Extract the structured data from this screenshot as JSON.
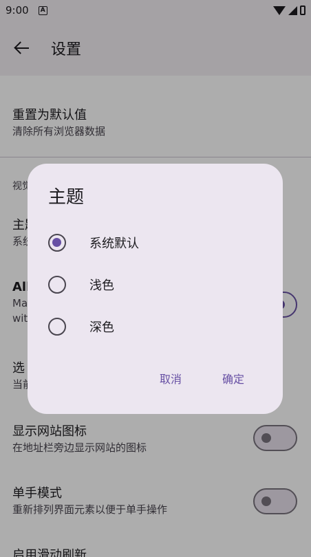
{
  "status_bar": {
    "time": "9:00",
    "notif_glyph": "A"
  },
  "app_bar": {
    "title": "设置",
    "back_icon": "arrow-left-icon"
  },
  "settings": {
    "reset": {
      "title": "重置为默认值",
      "subtitle": "清除所有浏览器数据"
    },
    "section_label": "视觉",
    "theme": {
      "title": "主题",
      "subtitle": "系统默认"
    },
    "all": {
      "title": "All",
      "subtitle_line1": "Ma",
      "subtitle_line2": "wit"
    },
    "tab": {
      "title": "选",
      "subtitle": "当前"
    },
    "favicon": {
      "title": "显示网站图标",
      "subtitle": "在地址栏旁边显示网站的图标",
      "enabled": false
    },
    "one_hand": {
      "title": "单手模式",
      "subtitle": "重新排列界面元素以便于单手操作",
      "enabled": false
    },
    "swipe_refresh": {
      "title": "启用滑动刷新"
    }
  },
  "dialog": {
    "title": "主题",
    "options": [
      {
        "label": "系统默认",
        "selected": true
      },
      {
        "label": "浅色",
        "selected": false
      },
      {
        "label": "深色",
        "selected": false
      }
    ],
    "cancel_label": "取消",
    "confirm_label": "确定"
  },
  "colors": {
    "accent": "#6750a4",
    "surface": "#f4eff4",
    "dialog": "#ece6f0"
  }
}
